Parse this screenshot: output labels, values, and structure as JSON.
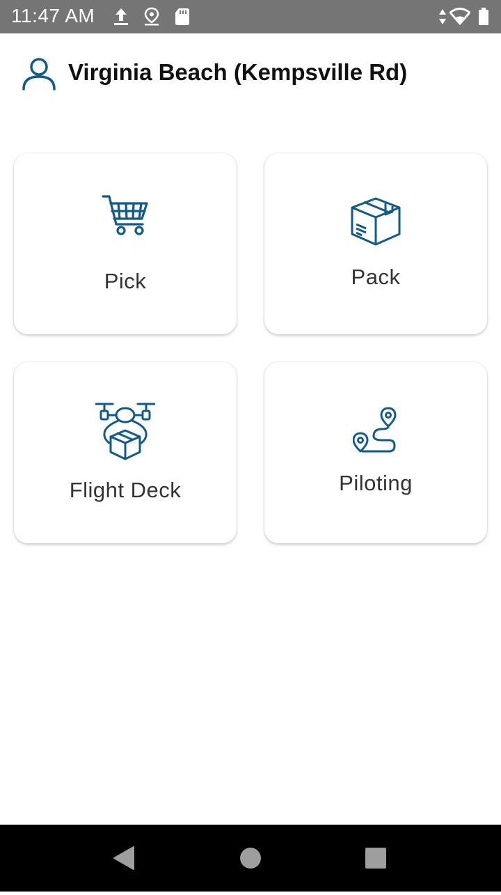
{
  "status_bar": {
    "time": "11:47 AM",
    "icons": [
      "upload-icon",
      "location-pin-icon",
      "sd-card-icon",
      "data-arrows-icon",
      "wifi-icon",
      "battery-icon"
    ]
  },
  "header": {
    "location_name": "Virginia Beach (Kempsville Rd)",
    "icon": "user-icon"
  },
  "tiles": [
    {
      "label": "Pick",
      "icon": "shopping-cart-icon"
    },
    {
      "label": "Pack",
      "icon": "package-box-icon"
    },
    {
      "label": "Flight Deck",
      "icon": "drone-package-icon"
    },
    {
      "label": "Piloting",
      "icon": "route-pins-icon"
    }
  ],
  "nav_bar": {
    "buttons": [
      "back-icon",
      "home-icon",
      "recents-icon"
    ]
  },
  "colors": {
    "accent": "#0f5a8e",
    "status_bar": "#757575",
    "nav_bar": "#000000",
    "tile_text": "#333333",
    "nav_icons": "#9e9e9e"
  }
}
